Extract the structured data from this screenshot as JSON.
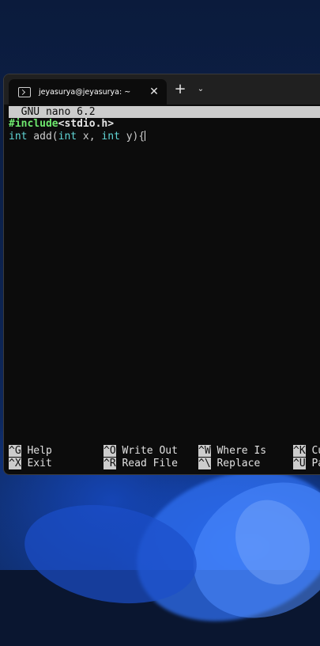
{
  "tab": {
    "title": "jeyasurya@jeyasurya: ~",
    "close_icon": "close-icon",
    "new_tab_label": "+",
    "dropdown_icon": "chevron-down-icon"
  },
  "nano": {
    "title": "  GNU nano 6.2",
    "lines": {
      "line1": {
        "directive": "#include",
        "header": "<stdio.h>"
      },
      "line2": {
        "kw1": "int",
        "fn": " add(",
        "kw2": "int",
        "mid": " x, ",
        "kw3": "int",
        "end": " y){"
      }
    }
  },
  "shortcuts": {
    "row1": [
      {
        "key": "^G",
        "label": " Help"
      },
      {
        "key": "^O",
        "label": " Write Out"
      },
      {
        "key": "^W",
        "label": " Where Is"
      },
      {
        "key": "^K",
        "label": " Cu"
      }
    ],
    "row2": [
      {
        "key": "^X",
        "label": " Exit"
      },
      {
        "key": "^R",
        "label": " Read File"
      },
      {
        "key": "^\\",
        "label": " Replace"
      },
      {
        "key": "^U",
        "label": " Pa"
      }
    ]
  },
  "colors": {
    "keyword": "#61d6d6",
    "preprocessor": "#6ee86e",
    "terminal_bg": "#0c0c0c",
    "titlebar_bg": "#cccccc"
  }
}
